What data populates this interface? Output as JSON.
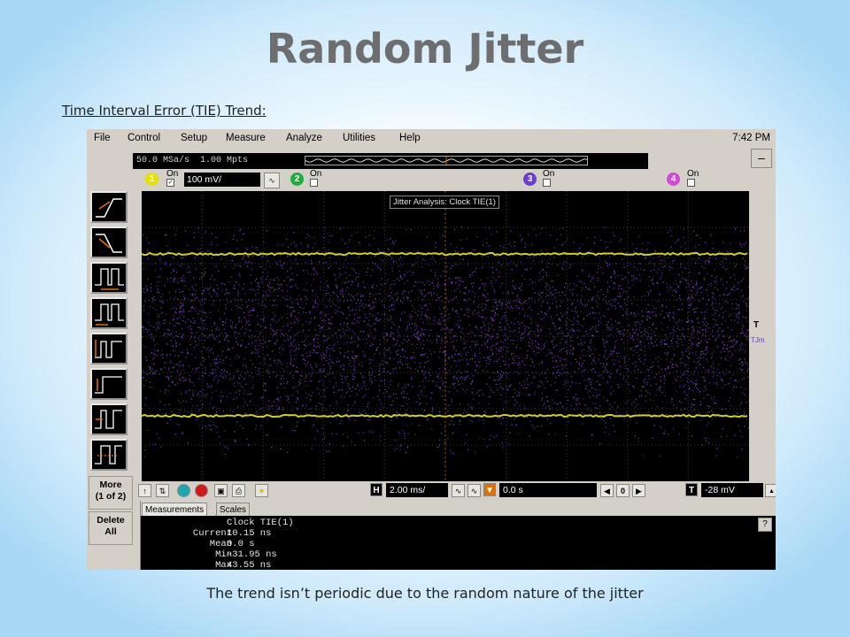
{
  "slide": {
    "title": "Random Jitter",
    "subtitle": "Time Interval Error (TIE) Trend:",
    "caption": "The trend isn’t periodic due to the random nature of the jitter"
  },
  "scope": {
    "menu": [
      "File",
      "Control",
      "Setup",
      "Measure",
      "Analyze",
      "Utilities",
      "Help"
    ],
    "clock": "7:42 PM",
    "status": {
      "sample_rate": "50.0 MSa/s",
      "memory_depth": "1.00 Mpts"
    },
    "channels": [
      {
        "number": "1",
        "on_label": "On",
        "enabled": true,
        "color": "#e8e000",
        "scale": "100 mV/"
      },
      {
        "number": "2",
        "on_label": "On",
        "enabled": false,
        "color": "#1fae3c"
      },
      {
        "number": "3",
        "on_label": "On",
        "enabled": false,
        "color": "#6a3fd0"
      },
      {
        "number": "4",
        "on_label": "On",
        "enabled": false,
        "color": "#d04bd6"
      }
    ],
    "side_buttons": {
      "more": "More",
      "more_page": "(1 of 2)",
      "delete": "Delete",
      "delete_all": "All"
    },
    "display": {
      "overlay_label": "Jitter Analysis: Clock TIE(1)",
      "trace_color": "#cfcf24",
      "noise_color": "#7a3fc4",
      "right_marker_top": "T",
      "right_marker_label": "TJm"
    },
    "toolbar": {
      "h_tag": "H",
      "time_per_div": "2.00 ms/",
      "delay": "0.0 s",
      "delay_zero": "0",
      "t_tag": "T",
      "trigger_level": "-28 mV"
    },
    "measurements": {
      "tabs": [
        "Measurements",
        "Scales"
      ],
      "header": "Clock TIE(1)",
      "rows": [
        {
          "label": "Current",
          "value": "10.15 ns"
        },
        {
          "label": "Mean",
          "value": "0.0 s"
        },
        {
          "label": "Min",
          "value": "-31.95 ns"
        },
        {
          "label": "Max",
          "value": "43.55 ns"
        }
      ],
      "help": "?"
    }
  }
}
